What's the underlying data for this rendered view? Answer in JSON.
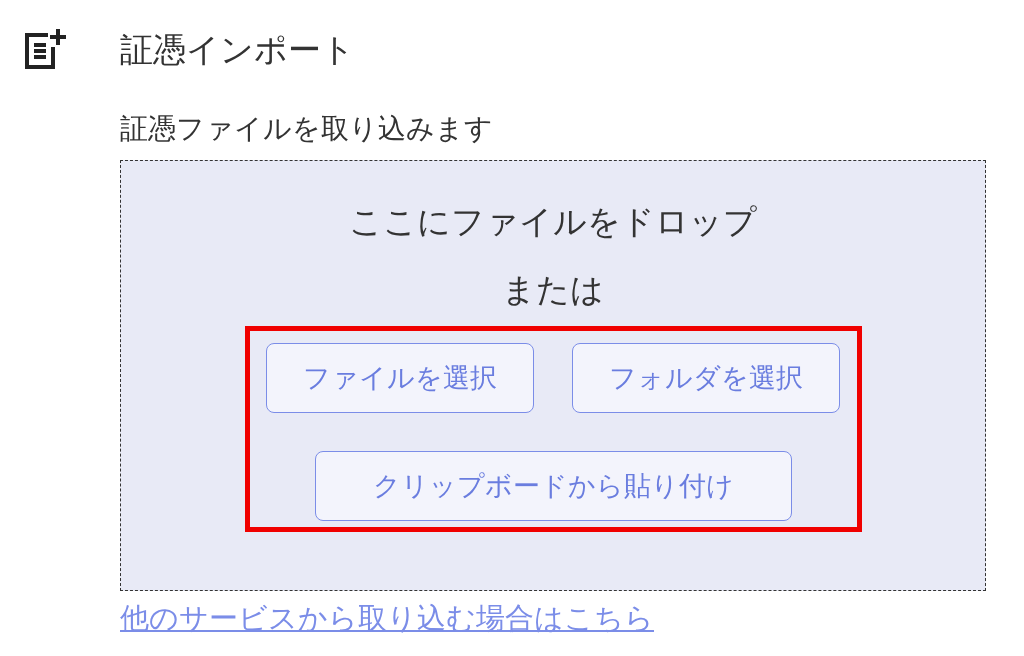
{
  "header": {
    "title": "証憑インポート"
  },
  "description": "証憑ファイルを取り込みます",
  "drop_zone": {
    "prompt": "ここにファイルをドロップ",
    "separator": "または",
    "button_group": {
      "highlighted": true,
      "buttons": [
        {
          "label": "ファイルを選択"
        },
        {
          "label": "フォルダを選択"
        },
        {
          "label": "クリップボードから貼り付け"
        }
      ]
    }
  },
  "link": "他のサービスから取り込む場合はこちら"
}
